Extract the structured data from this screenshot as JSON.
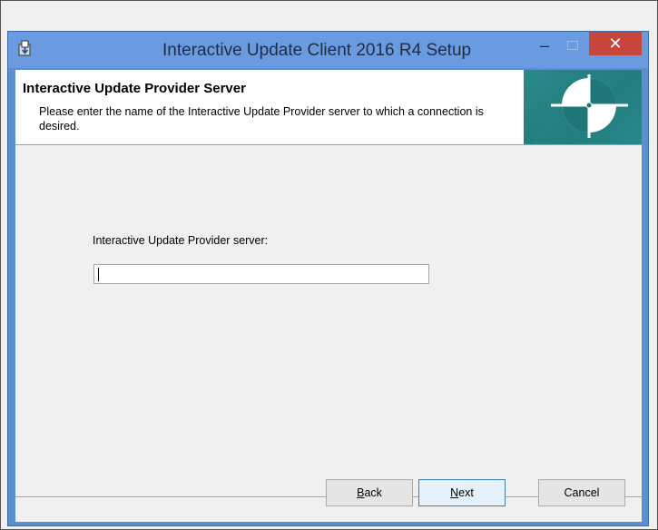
{
  "window": {
    "title": "Interactive Update Client 2016 R4 Setup",
    "minimize_glyph": "–",
    "close_glyph": "✕",
    "icon": "installer-icon"
  },
  "banner": {
    "title": "Interactive Update Provider Server",
    "description": "Please enter the name of the Interactive Update Provider server to which a connection is desired.",
    "logo": "compass-logo-icon"
  },
  "form": {
    "server_label": "Interactive Update Provider server:",
    "server_value": ""
  },
  "buttons": {
    "back_label": "Back",
    "back_accel": "B",
    "back_rest": "ack",
    "next_label": "Next",
    "next_accel": "N",
    "next_rest": "ext",
    "cancel_label": "Cancel"
  },
  "colors": {
    "titlebar": "#6a9be0",
    "close_button": "#c7463b",
    "banner_logo": "#2c8a8c"
  }
}
